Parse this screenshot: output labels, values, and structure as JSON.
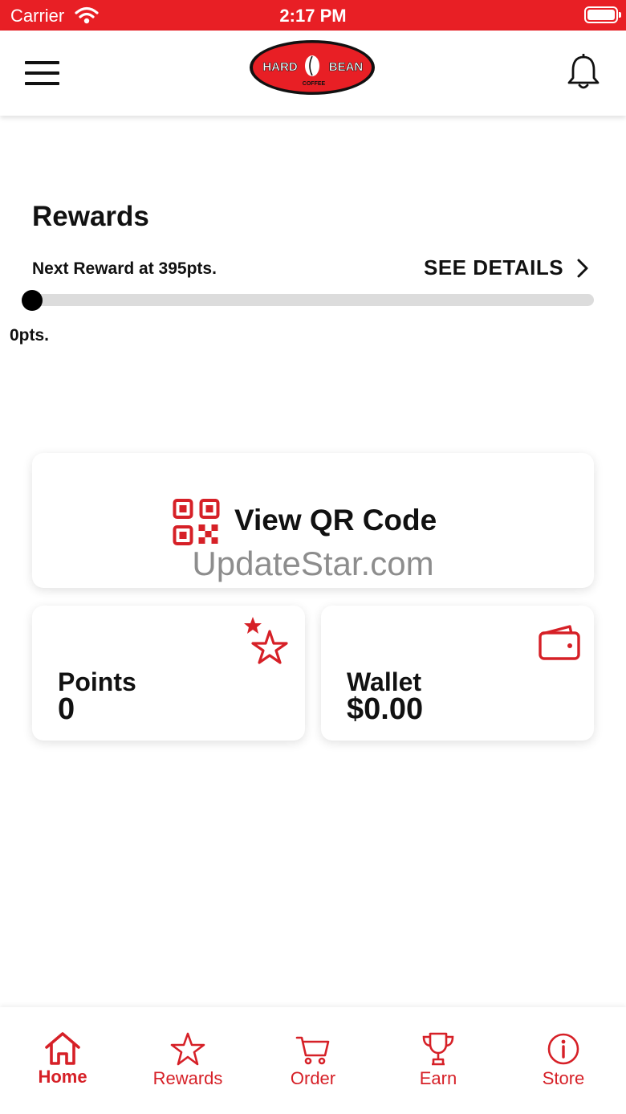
{
  "status_bar": {
    "carrier": "Carrier",
    "time": "2:17 PM"
  },
  "header": {
    "logo_text_left": "HARD",
    "logo_text_right": "BEAN",
    "logo_text_sub": "COFFEE"
  },
  "rewards": {
    "title": "Rewards",
    "next_reward": "Next Reward at 395pts.",
    "see_details": "SEE DETAILS",
    "current_points_label": "0pts.",
    "progress_fraction": 0
  },
  "qr_card": {
    "label": "View QR Code",
    "watermark": "UpdateStar.com"
  },
  "points_card": {
    "title": "Points",
    "value": "0"
  },
  "wallet_card": {
    "title": "Wallet",
    "value": "$0.00"
  },
  "tabs": [
    {
      "label": "Home",
      "icon": "home-icon",
      "active": true
    },
    {
      "label": "Rewards",
      "icon": "star-icon",
      "active": false
    },
    {
      "label": "Order",
      "icon": "cart-icon",
      "active": false
    },
    {
      "label": "Earn",
      "icon": "trophy-icon",
      "active": false
    },
    {
      "label": "Store",
      "icon": "info-icon",
      "active": false
    }
  ],
  "colors": {
    "accent": "#e81f25",
    "icon_red": "#d62027",
    "text": "#111111",
    "track": "#dcdcdc"
  }
}
